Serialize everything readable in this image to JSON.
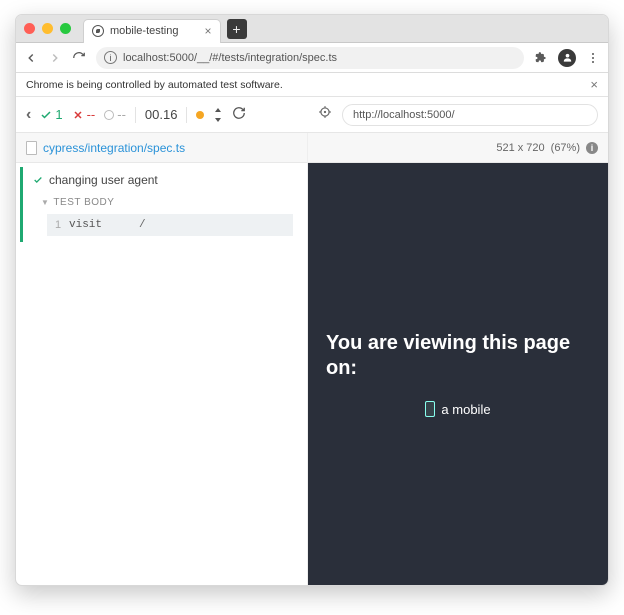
{
  "browser": {
    "tab_title": "mobile-testing",
    "address": "localhost:5000/__/#/tests/integration/spec.ts",
    "automation_banner": "Chrome is being controlled by automated test software."
  },
  "runner": {
    "passes": "1",
    "failures": "--",
    "pending": "--",
    "duration": "00.16",
    "url": "http://localhost:5000/",
    "spec_file": "cypress/integration/spec.ts",
    "viewport_label": "521 x 720",
    "scale_label": "(67%)"
  },
  "suite": {
    "name": "changing user agent",
    "section_label": "TEST BODY",
    "command": {
      "num": "1",
      "name": "visit",
      "arg": "/"
    }
  },
  "aut": {
    "heading": "You are viewing this page on:",
    "device": "a mobile"
  }
}
